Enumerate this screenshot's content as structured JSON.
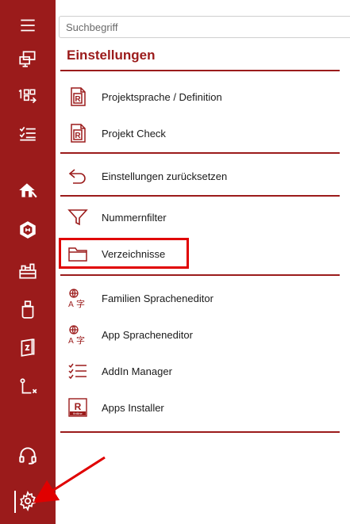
{
  "search": {
    "placeholder": "Suchbegriff"
  },
  "panel": {
    "title": "Einstellungen"
  },
  "items": [
    {
      "label": "Projektsprache / Definition",
      "icon": "revit-file-icon"
    },
    {
      "label": "Projekt Check",
      "icon": "revit-file-icon"
    },
    {
      "label": "Einstellungen zurücksetzen",
      "icon": "reset-arrow-icon"
    },
    {
      "label": "Nummernfilter",
      "icon": "filter-icon"
    },
    {
      "label": "Verzeichnisse",
      "icon": "folder-icon"
    },
    {
      "label": "Familien Spracheneditor",
      "icon": "language-icon"
    },
    {
      "label": "App Spracheneditor",
      "icon": "language-icon"
    },
    {
      "label": "AddIn Manager",
      "icon": "checklist-icon"
    },
    {
      "label": "Apps Installer",
      "icon": "apps-installer-icon"
    }
  ],
  "installer_icon_text": {
    "big": "R",
    "small": "fintline"
  },
  "colors": {
    "brand": "#9b1b1b",
    "highlight": "#e00000"
  }
}
